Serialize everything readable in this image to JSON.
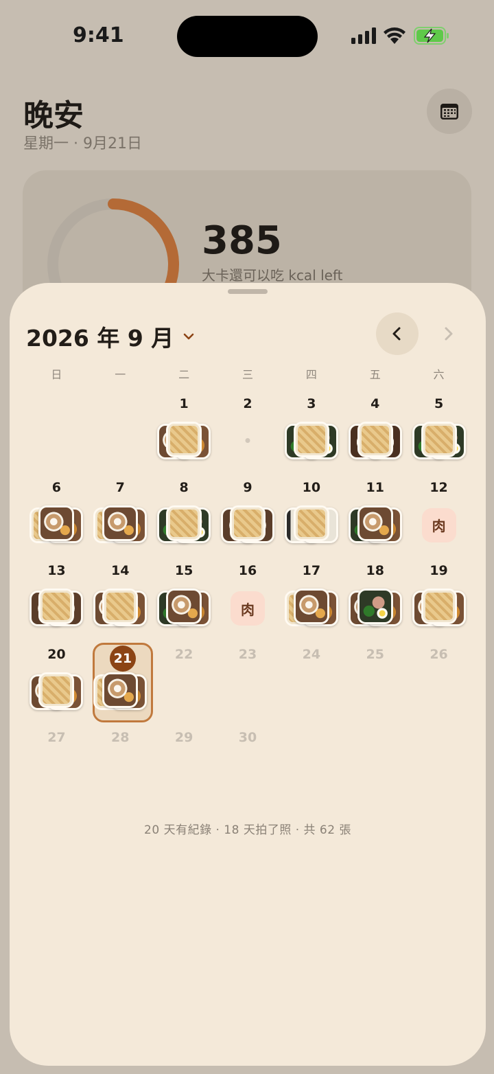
{
  "status_bar": {
    "time": "9:41"
  },
  "home": {
    "greeting": "晚安",
    "date": "星期一 · 9月21日",
    "calories_left": "385",
    "calories_label": "大卡還可以吃 kcal left",
    "ring_progress": 0.55
  },
  "calendar": {
    "month_label": "2026 年 9 月",
    "weekdays": [
      "日",
      "一",
      "二",
      "三",
      "四",
      "五",
      "六"
    ],
    "today": 21,
    "summary": "20 天有紀錄 · 18 天拍了照 · 共 62 張",
    "days": [
      {
        "day": "",
        "state": "blank"
      },
      {
        "day": "",
        "state": "blank"
      },
      {
        "day": "1",
        "state": "photos",
        "photos": [
          "f-latte",
          "f-toast",
          "f-fries"
        ]
      },
      {
        "day": "2",
        "state": "empty"
      },
      {
        "day": "3",
        "state": "photos",
        "photos": [
          "f-salad",
          "f-salad",
          "f-fries"
        ]
      },
      {
        "day": "4",
        "state": "photos",
        "photos": [
          "f-curry",
          "f-curry",
          "f-fries"
        ]
      },
      {
        "day": "5",
        "state": "photos",
        "photos": [
          "f-salad",
          "f-salad",
          "f-fries"
        ]
      },
      {
        "day": "6",
        "state": "photos",
        "photos": [
          "f-fries",
          "f-toast",
          "f-latte"
        ]
      },
      {
        "day": "7",
        "state": "photos",
        "photos": [
          "f-fries",
          "f-toast",
          "f-latte"
        ]
      },
      {
        "day": "8",
        "state": "photos",
        "photos": [
          "f-salad",
          "f-salad",
          "f-fries"
        ]
      },
      {
        "day": "9",
        "state": "photos",
        "photos": [
          "f-stew",
          "f-stew",
          "f-fries"
        ]
      },
      {
        "day": "10",
        "state": "photos",
        "photos": [
          "f-bento",
          "f-bento",
          "f-fries"
        ]
      },
      {
        "day": "11",
        "state": "photos",
        "photos": [
          "f-salad",
          "f-toast",
          "f-latte"
        ]
      },
      {
        "day": "12",
        "state": "label",
        "label": "肉"
      },
      {
        "day": "13",
        "state": "photos",
        "photos": [
          "f-stew",
          "f-stew",
          "f-fries"
        ]
      },
      {
        "day": "14",
        "state": "photos",
        "photos": [
          "f-latte",
          "f-toast",
          "f-fries"
        ]
      },
      {
        "day": "15",
        "state": "photos",
        "photos": [
          "f-salad",
          "f-toast",
          "f-latte"
        ]
      },
      {
        "day": "16",
        "state": "label",
        "label": "肉"
      },
      {
        "day": "17",
        "state": "photos",
        "photos": [
          "f-fries",
          "f-toast",
          "f-latte"
        ]
      },
      {
        "day": "18",
        "state": "photos",
        "photos": [
          "f-latte",
          "f-toast",
          "f-salad"
        ]
      },
      {
        "day": "19",
        "state": "photos",
        "photos": [
          "f-latte",
          "f-toast",
          "f-fries"
        ]
      },
      {
        "day": "20",
        "state": "photos",
        "photos": [
          "f-latte",
          "f-toast",
          "f-fries"
        ]
      },
      {
        "day": "21",
        "state": "today",
        "photos": [
          "f-fries",
          "f-toast",
          "f-latte"
        ]
      },
      {
        "day": "22",
        "state": "future"
      },
      {
        "day": "23",
        "state": "future"
      },
      {
        "day": "24",
        "state": "future"
      },
      {
        "day": "25",
        "state": "future"
      },
      {
        "day": "26",
        "state": "future"
      },
      {
        "day": "27",
        "state": "future"
      },
      {
        "day": "28",
        "state": "future"
      },
      {
        "day": "29",
        "state": "future"
      },
      {
        "day": "30",
        "state": "future"
      }
    ]
  },
  "icons": {
    "calendar_button": "calendar-icon",
    "prev": "chevron-left-icon",
    "next": "chevron-right-icon",
    "month_picker": "chevron-down-icon"
  },
  "colors": {
    "accent": "#8c4415",
    "today_border": "#c0793d",
    "ring": "#b46a36",
    "sheet": "#f4e9d9",
    "meat_chip": "#fbdcce"
  }
}
